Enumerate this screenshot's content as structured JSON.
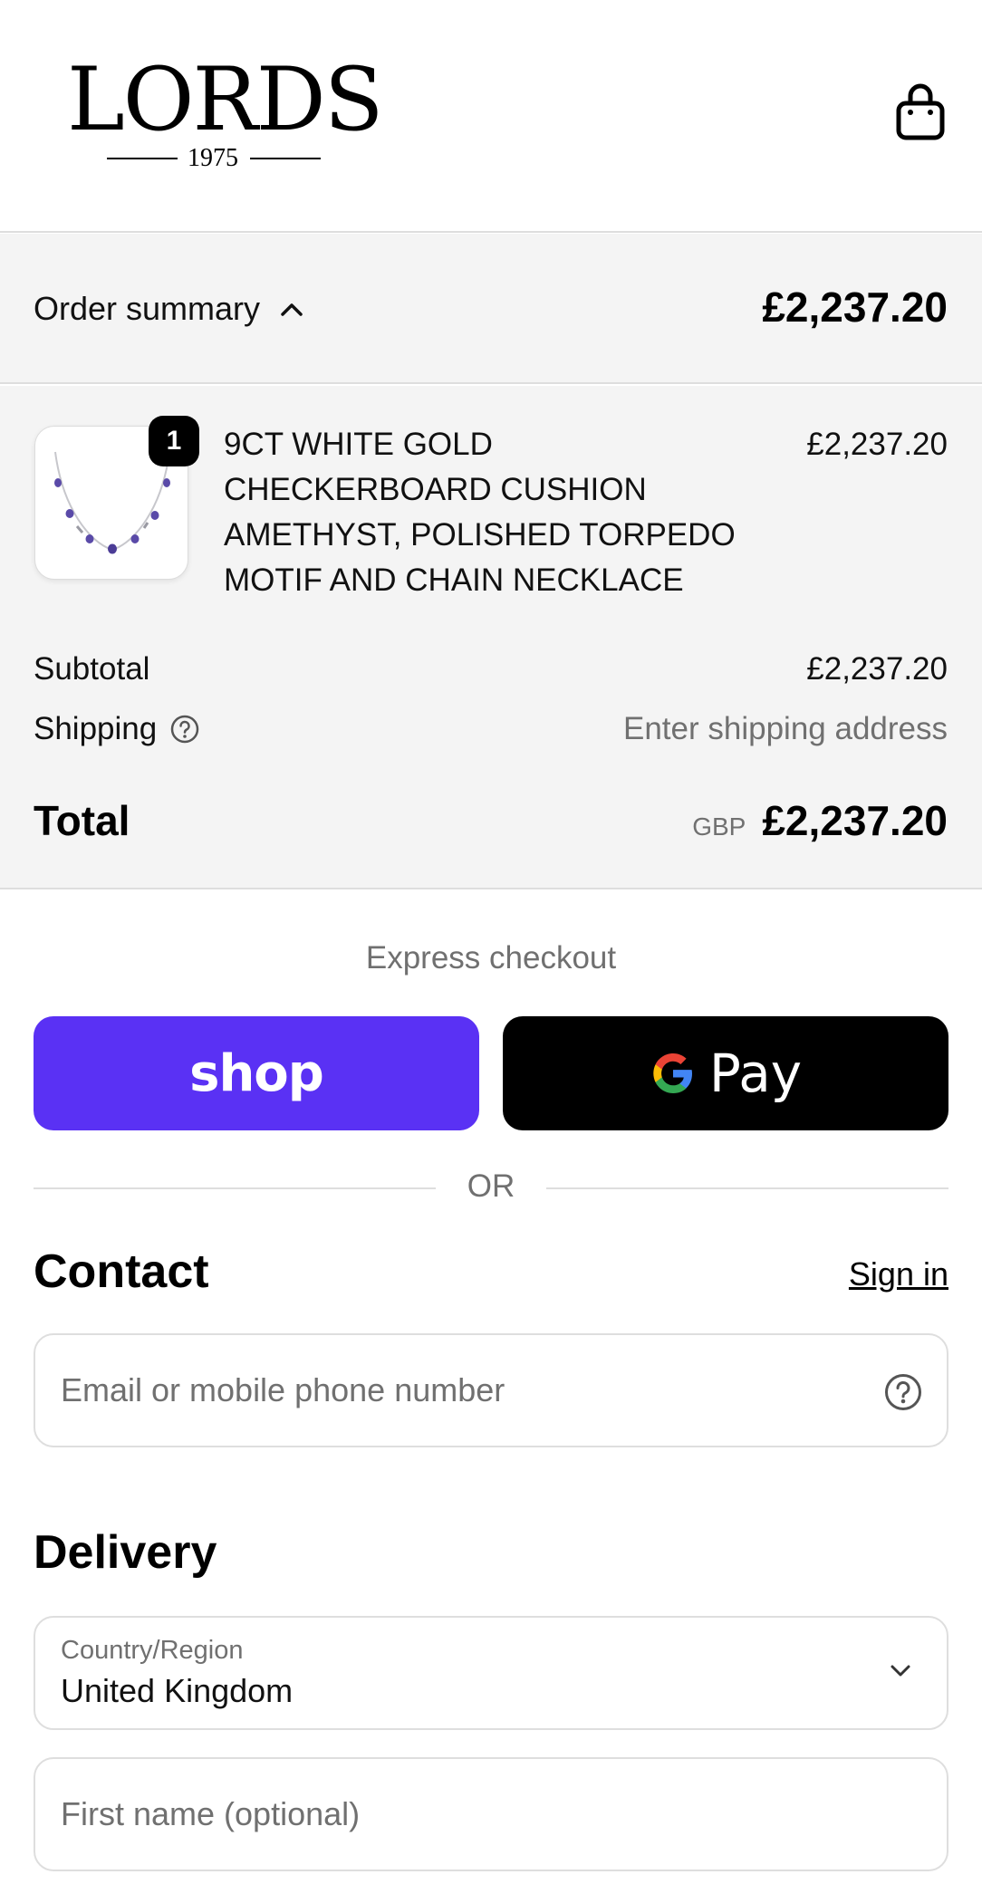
{
  "header": {
    "logo_word": "LORDS",
    "logo_year": "1975"
  },
  "summary": {
    "toggle_label": "Order summary",
    "total": "£2,237.20"
  },
  "product": {
    "quantity": "1",
    "name": "9CT WHITE GOLD CHECKERBOARD CUSHION AMETHYST, POLISHED TORPEDO MOTIF AND CHAIN NECKLACE",
    "price": "£2,237.20"
  },
  "costs": {
    "subtotal_label": "Subtotal",
    "subtotal_value": "£2,237.20",
    "shipping_label": "Shipping",
    "shipping_value": "Enter shipping address",
    "total_label": "Total",
    "currency": "GBP",
    "total_value": "£2,237.20"
  },
  "express": {
    "title": "Express checkout",
    "shop_label": "shop",
    "gpay_label": "Pay",
    "or_label": "OR"
  },
  "contact": {
    "title": "Contact",
    "signin_label": "Sign in",
    "email_placeholder": "Email or mobile phone number"
  },
  "delivery": {
    "title": "Delivery",
    "country_label": "Country/Region",
    "country_value": "United Kingdom",
    "first_name_placeholder": "First name (optional)"
  },
  "colors": {
    "shop_purple": "#5a31f4",
    "gpay_black": "#000000",
    "summary_bg": "#f4f4f4",
    "muted_text": "#707070",
    "amethyst": "#5a4aa8"
  },
  "icons": {
    "cart": "shopping-bag-icon",
    "toggle": "chevron-up-icon",
    "help": "question-circle-icon",
    "select": "chevron-down-icon",
    "google": "google-g-icon"
  }
}
